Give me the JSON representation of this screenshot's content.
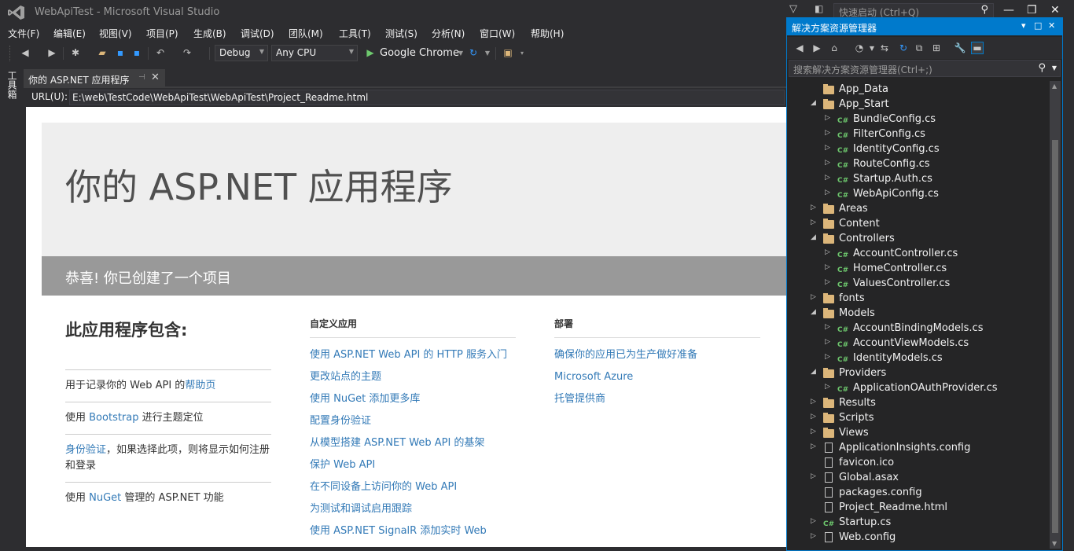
{
  "window": {
    "title": "WebApiTest - Microsoft Visual Studio",
    "quick_launch_placeholder": "快速启动 (Ctrl+Q)"
  },
  "menu": [
    "文件(F)",
    "编辑(E)",
    "视图(V)",
    "项目(P)",
    "生成(B)",
    "调试(D)",
    "团队(M)",
    "工具(T)",
    "测试(S)",
    "分析(N)",
    "窗口(W)",
    "帮助(H)"
  ],
  "toolbar": {
    "config": "Debug",
    "platform": "Any CPU",
    "run_target": "Google Chrome"
  },
  "side": {
    "toolbox_label": "工具箱"
  },
  "document_tab": {
    "label": "你的 ASP.NET 应用程序"
  },
  "url_bar": {
    "label": "URL(U):",
    "value": "E:\\web\\TestCode\\WebApiTest\\WebApiTest\\Project_Readme.html"
  },
  "page": {
    "jumbo_title": "你的 ASP.NET 应用程序",
    "banner": "恭喜! 你已创建了一个项目",
    "col_a": {
      "heading": "此应用程序包含:",
      "rows": [
        {
          "pre": "用于记录你的 Web API 的",
          "link": "帮助页",
          "post": ""
        },
        {
          "pre": "使用 ",
          "link": "Bootstrap",
          "post": " 进行主题定位"
        },
        {
          "pre": "",
          "link": "身份验证",
          "post": "，如果选择此项，则将显示如何注册和登录"
        },
        {
          "pre": "使用 ",
          "link": "NuGet",
          "post": " 管理的 ASP.NET 功能"
        }
      ]
    },
    "col_b": {
      "heading": "自定义应用",
      "links": [
        "使用 ASP.NET Web API 的 HTTP 服务入门",
        "更改站点的主题",
        "使用 NuGet 添加更多库",
        "配置身份验证",
        "从模型搭建 ASP.NET Web API 的基架",
        "保护 Web API",
        "在不同设备上访问你的 Web API",
        "为测试和调试启用跟踪",
        "使用 ASP.NET SignalR 添加实时 Web"
      ]
    },
    "col_c": {
      "heading": "部署",
      "links": [
        "确保你的应用已为生产做好准备",
        "Microsoft Azure",
        "托管提供商"
      ]
    }
  },
  "solution_explorer": {
    "title": "解决方案资源管理器",
    "search_placeholder": "搜索解决方案资源管理器(Ctrl+;)",
    "nodes": [
      {
        "label": "App_Data",
        "depth": 1,
        "type": "folder",
        "exp": ""
      },
      {
        "label": "App_Start",
        "depth": 1,
        "type": "folder",
        "exp": "open"
      },
      {
        "label": "BundleConfig.cs",
        "depth": 2,
        "type": "cs",
        "exp": "closed"
      },
      {
        "label": "FilterConfig.cs",
        "depth": 2,
        "type": "cs",
        "exp": "closed"
      },
      {
        "label": "IdentityConfig.cs",
        "depth": 2,
        "type": "cs",
        "exp": "closed"
      },
      {
        "label": "RouteConfig.cs",
        "depth": 2,
        "type": "cs",
        "exp": "closed"
      },
      {
        "label": "Startup.Auth.cs",
        "depth": 2,
        "type": "cs",
        "exp": "closed"
      },
      {
        "label": "WebApiConfig.cs",
        "depth": 2,
        "type": "cs",
        "exp": "closed"
      },
      {
        "label": "Areas",
        "depth": 1,
        "type": "folder",
        "exp": "closed"
      },
      {
        "label": "Content",
        "depth": 1,
        "type": "folder",
        "exp": "closed"
      },
      {
        "label": "Controllers",
        "depth": 1,
        "type": "folder",
        "exp": "open"
      },
      {
        "label": "AccountController.cs",
        "depth": 2,
        "type": "cs",
        "exp": "closed"
      },
      {
        "label": "HomeController.cs",
        "depth": 2,
        "type": "cs",
        "exp": "closed"
      },
      {
        "label": "ValuesController.cs",
        "depth": 2,
        "type": "cs",
        "exp": "closed"
      },
      {
        "label": "fonts",
        "depth": 1,
        "type": "folder",
        "exp": "closed"
      },
      {
        "label": "Models",
        "depth": 1,
        "type": "folder",
        "exp": "open"
      },
      {
        "label": "AccountBindingModels.cs",
        "depth": 2,
        "type": "cs",
        "exp": "closed"
      },
      {
        "label": "AccountViewModels.cs",
        "depth": 2,
        "type": "cs",
        "exp": "closed"
      },
      {
        "label": "IdentityModels.cs",
        "depth": 2,
        "type": "cs",
        "exp": "closed"
      },
      {
        "label": "Providers",
        "depth": 1,
        "type": "folder",
        "exp": "open"
      },
      {
        "label": "ApplicationOAuthProvider.cs",
        "depth": 2,
        "type": "cs",
        "exp": "closed"
      },
      {
        "label": "Results",
        "depth": 1,
        "type": "folder",
        "exp": "closed"
      },
      {
        "label": "Scripts",
        "depth": 1,
        "type": "folder",
        "exp": "closed"
      },
      {
        "label": "Views",
        "depth": 1,
        "type": "folder",
        "exp": "closed"
      },
      {
        "label": "ApplicationInsights.config",
        "depth": 1,
        "type": "file",
        "exp": "closed"
      },
      {
        "label": "favicon.ico",
        "depth": 1,
        "type": "file",
        "exp": ""
      },
      {
        "label": "Global.asax",
        "depth": 1,
        "type": "file",
        "exp": "closed"
      },
      {
        "label": "packages.config",
        "depth": 1,
        "type": "file",
        "exp": ""
      },
      {
        "label": "Project_Readme.html",
        "depth": 1,
        "type": "file",
        "exp": ""
      },
      {
        "label": "Startup.cs",
        "depth": 1,
        "type": "cs",
        "exp": "closed"
      },
      {
        "label": "Web.config",
        "depth": 1,
        "type": "file",
        "exp": "closed"
      }
    ]
  },
  "colors": {
    "accent": "#007acc",
    "link": "#337ab7",
    "folder": "#dcb67a",
    "cs": "#6ec96e"
  }
}
